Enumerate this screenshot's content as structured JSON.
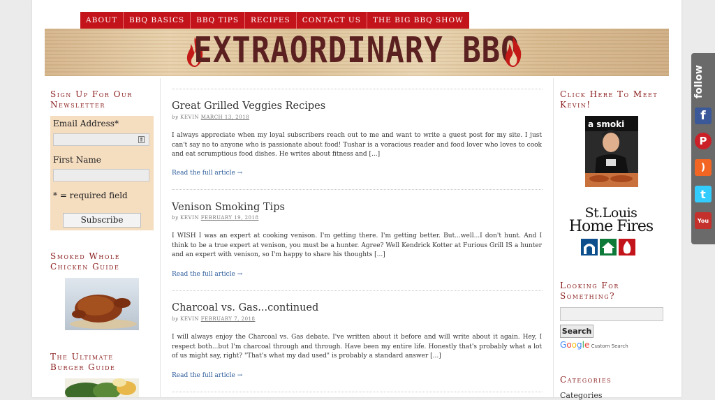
{
  "nav": {
    "items": [
      "ABOUT",
      "BBQ BASICS",
      "BBQ TIPS",
      "RECIPES",
      "CONTACT US",
      "THE BIG BBQ SHOW"
    ]
  },
  "banner": {
    "title": "EXTRAORDINARY BBQ",
    "flame_icon": "flame-icon"
  },
  "newsletter": {
    "heading": "Sign Up For Our Newsletter",
    "email_label": "Email Address*",
    "first_name_label": "First Name",
    "required_note": "* = required field",
    "subscribe_label": "Subscribe"
  },
  "left_sidebar": {
    "chicken_heading": "Smoked Whole Chicken Guide",
    "burger_heading": "The Ultimate Burger Guide"
  },
  "posts": [
    {
      "title": "Great Grilled Veggies Recipes",
      "by": "by",
      "author": "KEVIN",
      "date": "MARCH 13, 2018",
      "excerpt": "I always appreciate when my loyal subscribers reach out to me and want to write a guest post for my site. I just can't say no to anyone who is passionate about food! Tushar is a voracious reader and food lover who loves to cook and eat scrumptious food dishes. He writes about fitness and [...]",
      "link": "Read the full article →"
    },
    {
      "title": "Venison Smoking Tips",
      "by": "by",
      "author": "KEVIN",
      "date": "FEBRUARY 19, 2018",
      "excerpt": "I WISH I was an expert at cooking venison. I'm getting there. I'm getting better. But...well...I don't hunt. And I think to be a true expert at venison, you must be a hunter. Agree? Well Kendrick Kotter at Furious Grill IS a hunter and an expert with venison, so I'm happy to share his thoughts [...]",
      "link": "Read the full article →"
    },
    {
      "title": "Charcoal vs. Gas...continued",
      "by": "by",
      "author": "KEVIN",
      "date": "FEBRUARY 7, 2018",
      "excerpt": "I will always enjoy the Charcoal vs. Gas debate. I've written about it before and will write about it again. Hey, I respect both...but I'm charcoal through and through. Have been my entire life. Honestly that's probably what a lot of us might say, right? \"That's what my dad used\" is probably a standard answer [...]",
      "link": "Read the full article →"
    }
  ],
  "right_sidebar": {
    "meet_heading": "Click Here To Meet Kevin!",
    "kevin_sign_text": "a smoki",
    "home_fires_logo": {
      "line1": "St.Louis",
      "line2": "Home Fires"
    },
    "search_heading": "Looking For Something?",
    "search_button": "Search",
    "google_letters": [
      "G",
      "o",
      "o",
      "g",
      "l",
      "e"
    ],
    "custom_search": "Custom Search",
    "categories_heading": "Categories",
    "categories_text": "Categories"
  },
  "follow": {
    "label": "follow",
    "icons": [
      {
        "name": "facebook-icon",
        "glyph": "f",
        "color": "#3b5998"
      },
      {
        "name": "pinterest-icon",
        "glyph": "P",
        "color": "#cb2027"
      },
      {
        "name": "rss-icon",
        "glyph": ")",
        "color": "#f26522"
      },
      {
        "name": "twitter-icon",
        "glyph": "t",
        "color": "#33ccff"
      },
      {
        "name": "youtube-icon",
        "glyph": "You",
        "color": "#c4302b"
      }
    ]
  },
  "colors": {
    "nav_red": "#c4141b",
    "heading_red": "#8a1c1c",
    "newsletter_bg": "#f5ddc0",
    "link_blue": "#2a5a9a"
  }
}
